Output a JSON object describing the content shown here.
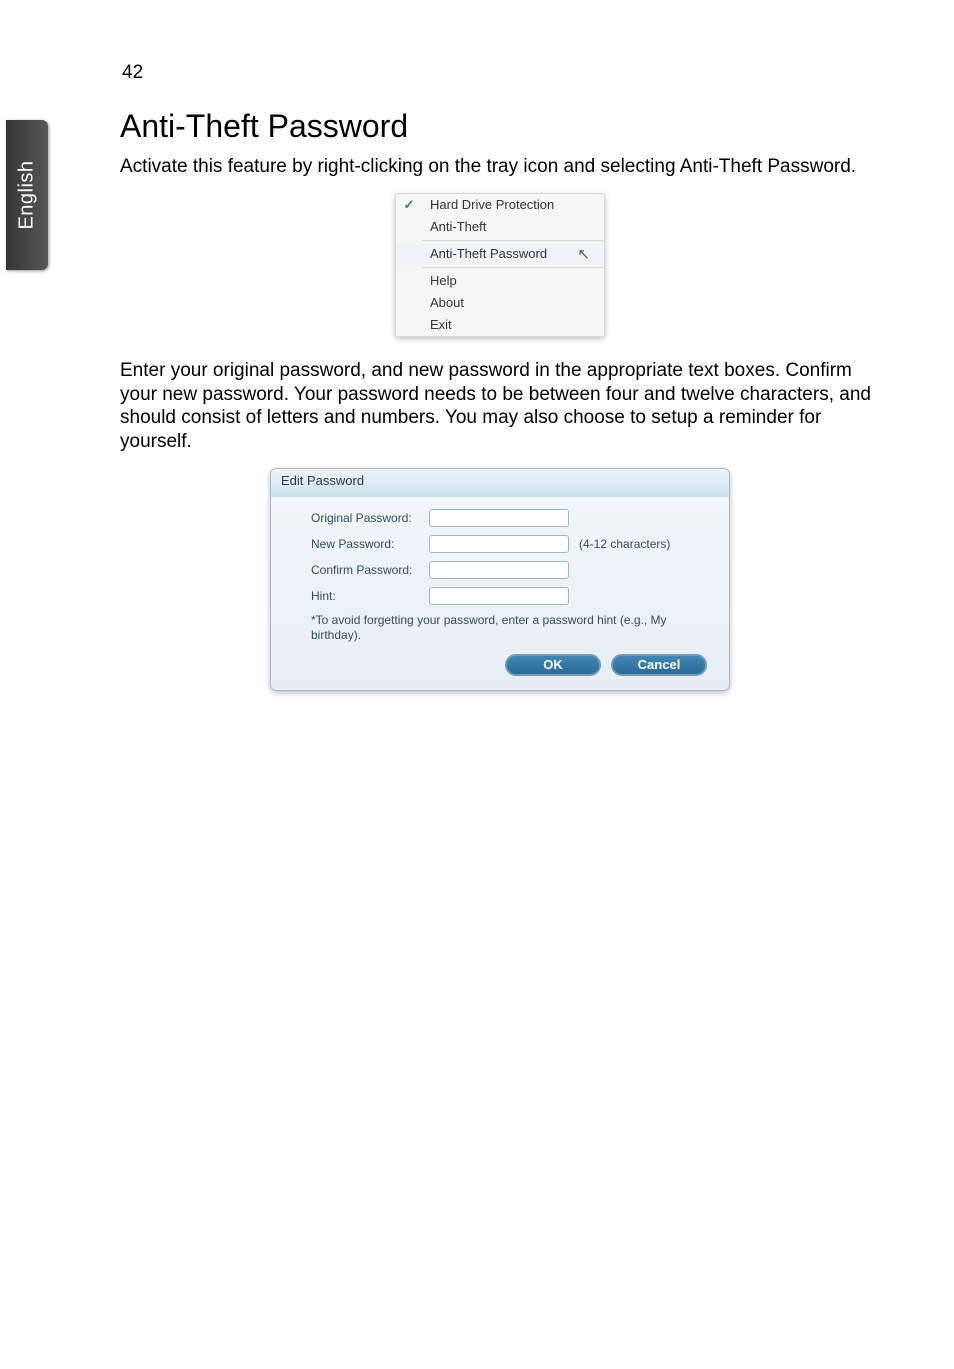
{
  "page_number": "42",
  "language_tab": "English",
  "heading": "Anti-Theft Password",
  "intro_paragraph": "Activate this feature by right-clicking on the tray icon and selecting Anti-Theft Password.",
  "context_menu": {
    "items": [
      {
        "label": "Hard Drive Protection",
        "checked": true
      },
      {
        "label": "Anti-Theft",
        "checked": false
      }
    ],
    "items2": [
      {
        "label": "Anti-Theft Password",
        "hovered": true
      }
    ],
    "items3": [
      {
        "label": "Help"
      },
      {
        "label": "About"
      },
      {
        "label": "Exit"
      }
    ]
  },
  "second_paragraph": "Enter your original password, and new password in the appropriate text boxes. Confirm your new password. Your password needs to be between four and twelve characters, and should consist of letters and numbers. You may also choose to setup a reminder for yourself.",
  "dialog": {
    "title": "Edit Password",
    "fields": {
      "original_label": "Original Password:",
      "new_label": "New Password:",
      "new_suffix": "(4-12 characters)",
      "confirm_label": "Confirm Password:",
      "hint_label": "Hint:"
    },
    "note": "*To avoid forgetting your password, enter a password hint (e.g., My birthday).",
    "buttons": {
      "ok": "OK",
      "cancel": "Cancel"
    }
  }
}
